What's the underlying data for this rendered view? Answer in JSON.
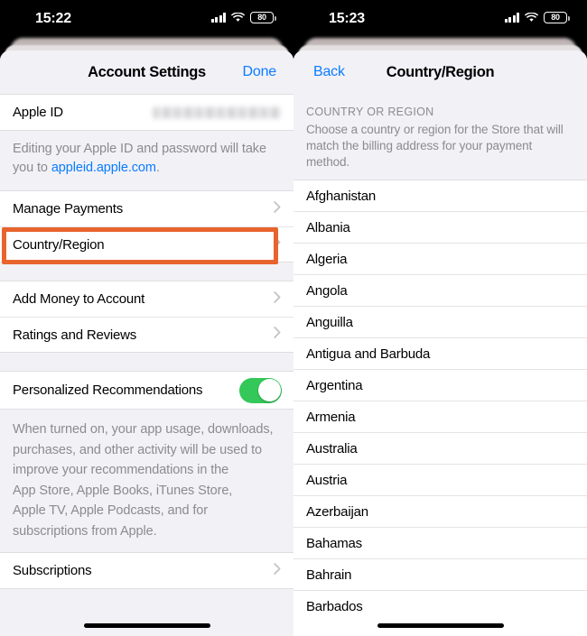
{
  "left": {
    "statusbar": {
      "time": "15:22",
      "battery_level": "80",
      "cellular_icon": "signal-bars-icon",
      "wifi_icon": "wifi-icon",
      "battery_icon": "battery-icon"
    },
    "nav": {
      "title": "Account Settings",
      "right_button": "Done"
    },
    "apple_id_row": {
      "label": "Apple ID",
      "value_redacted": ""
    },
    "apple_id_footnote": {
      "prefix": "Editing your Apple ID and password will take you to ",
      "link": "appleid.apple.com",
      "suffix": "."
    },
    "rows_group_2": [
      {
        "label": "Manage Payments",
        "accessory": "chevron-right-icon"
      },
      {
        "label": "Country/Region",
        "accessory": "chevron-right-icon",
        "highlighted": true
      }
    ],
    "rows_group_3": [
      {
        "label": "Add Money to Account",
        "accessory": "chevron-right-icon"
      },
      {
        "label": "Ratings and Reviews",
        "accessory": "chevron-right-icon"
      }
    ],
    "toggle_row": {
      "label": "Personalized Recommendations",
      "state": "on",
      "accessory": "toggle-switch"
    },
    "toggle_footnote": "When turned on, your app usage, downloads,\npurchases, and other activity will be used to\nimprove your recommendations in the\nApp Store, Apple Books, iTunes Store,\nApple TV, Apple Podcasts, and for\nsubscriptions from Apple.",
    "rows_group_4": [
      {
        "label": "Subscriptions",
        "accessory": "chevron-right-icon"
      }
    ]
  },
  "right": {
    "statusbar": {
      "time": "15:23",
      "battery_level": "80",
      "cellular_icon": "signal-bars-icon",
      "wifi_icon": "wifi-icon",
      "battery_icon": "battery-icon"
    },
    "nav": {
      "left_button": "Back",
      "title": "Country/Region"
    },
    "section": {
      "title": "COUNTRY OR REGION",
      "description": "Choose a country or region for the Store that will match the billing address for your payment method."
    },
    "countries": [
      "Afghanistan",
      "Albania",
      "Algeria",
      "Angola",
      "Anguilla",
      "Antigua and Barbuda",
      "Argentina",
      "Armenia",
      "Australia",
      "Austria",
      "Azerbaijan",
      "Bahamas",
      "Bahrain",
      "Barbados"
    ]
  },
  "colors": {
    "accent_blue": "#0a7cff",
    "toggle_green": "#34c759",
    "highlight_orange": "#e8642e",
    "group_background": "#f2f1f6",
    "row_background": "#ffffff",
    "secondary_text": "#8b8b90"
  }
}
